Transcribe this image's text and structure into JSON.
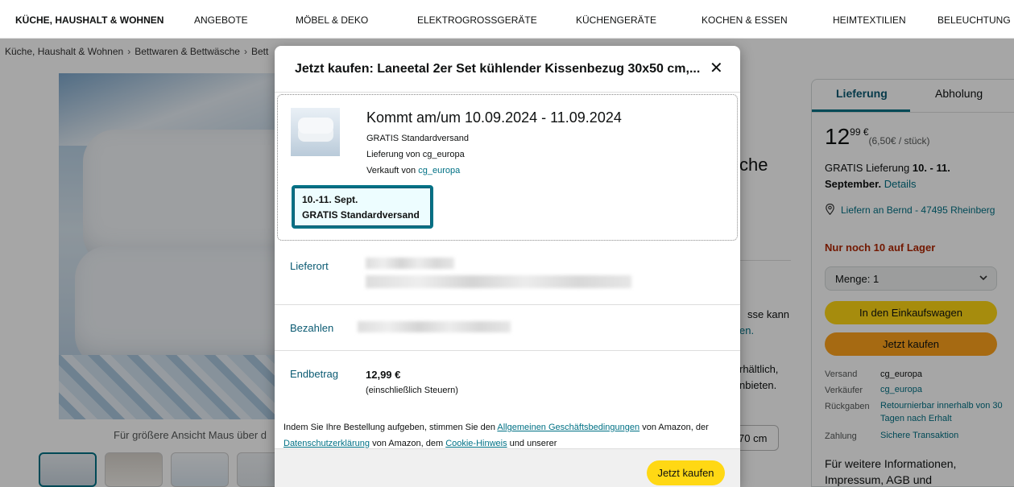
{
  "nav": {
    "items": [
      "KÜCHE, HAUSHALT & WOHNEN",
      "ANGEBOTE",
      "MÖBEL & DEKO",
      "ELEKTROGROSSGERÄTE",
      "KÜCHENGERÄTE",
      "KOCHEN & ESSEN",
      "HEIMTEXTILIEN",
      "BELEUCHTUNG"
    ]
  },
  "breadcrumb": [
    "Küche, Haushalt & Wohnen",
    "Bettwaren & Bettwäsche",
    "Bett"
  ],
  "product": {
    "image_hint": "Für größere Ansicht Maus über d",
    "title_fragment": "che",
    "text_fragments": [
      "sse kann",
      "en.",
      "rhältlich,",
      "nbieten."
    ],
    "size_label": "70 cm"
  },
  "buybox": {
    "tab_delivery": "Lieferung",
    "tab_pickup": "Abholung",
    "price_int": "12",
    "price_frac": "99 €",
    "unit_price": "(6,50€ / stück)",
    "free_delivery_prefix": "GRATIS Lieferung ",
    "free_delivery_dates": "10. - 11. September.",
    "details_link": "Details",
    "deliver_to": "Liefern an Bernd - 47495 Rheinberg",
    "stock": "Nur noch 10 auf Lager",
    "quantity": "Menge:  1",
    "add_to_cart": "In den Einkaufswagen",
    "buy_now": "Jetzt kaufen",
    "info": [
      {
        "label": "Versand",
        "value": "cg_europa"
      },
      {
        "label": "Verkäufer",
        "value": "cg_europa"
      },
      {
        "label": "Rückgaben",
        "value": "Retournierbar innerhalb von 30 Tagen nach Erhalt"
      },
      {
        "label": "Zahlung",
        "value": "Sichere Transaktion"
      }
    ],
    "more_info": "Für weitere Informationen, Impressum, AGB und"
  },
  "modal": {
    "title": "Jetzt kaufen: Laneetal 2er Set kühlender Kissenbezug 30x50 cm,...",
    "close_label": "✕",
    "arrival": "Kommt am/um 10.09.2024 - 11.09.2024",
    "shipping_method": "GRATIS Standardversand",
    "delivered_by": "Lieferung von cg_europa",
    "sold_by_prefix": "Verkauft von ",
    "sold_by_link": "cg_europa",
    "option_dates": "10.-11. Sept.",
    "option_method": "GRATIS Standardversand",
    "ship_to_label": "Lieferort",
    "pay_label": "Bezahlen",
    "total_label": "Endbetrag",
    "total_value": "12,99 €",
    "tax_note": "(einschließlich Steuern)",
    "legal_1": "Indem Sie Ihre Bestellung aufgeben, stimmen Sie den ",
    "legal_link_1": "Allgemeinen Geschäftsbedingungen",
    "legal_2": " von Amazon, der ",
    "legal_link_2": "Datenschutzerklärung",
    "legal_3": " von Amazon, dem ",
    "legal_link_3": "Cookie-Hinweis",
    "legal_4": " und unserer",
    "confirm_button": "Jetzt kaufen"
  },
  "colors": {
    "link": "#007185",
    "yellow_button": "#ffd814",
    "orange_button": "#ffa41c",
    "stock_red": "#b12704"
  }
}
